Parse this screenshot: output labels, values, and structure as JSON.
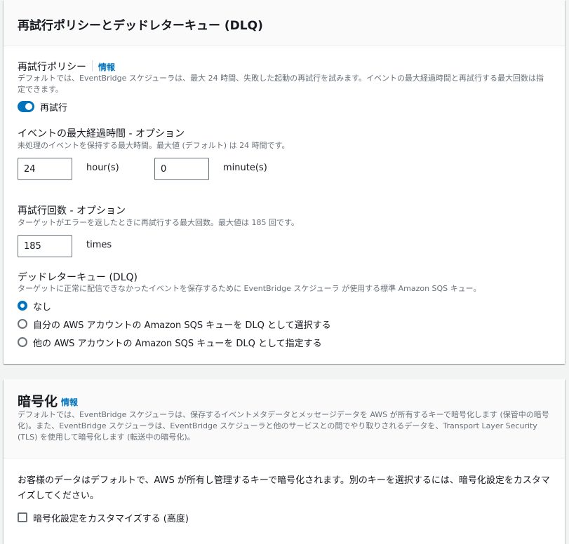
{
  "retry_section": {
    "title": "再試行ポリシーとデッドレターキュー (DLQ)",
    "retry_policy": {
      "label": "再試行ポリシー",
      "info": "情報",
      "description": "デフォルトでは、EventBridge スケジューラは、最大 24 時間、失敗した起動の再試行を試みます。イベントの最大経過時間と再試行する最大回数は指定できます。",
      "toggle_label": "再試行",
      "toggle_on": true
    },
    "max_age": {
      "label": "イベントの最大経過時間 - オプション",
      "description": "未処理のイベントを保持する最大時間。最大値 (デフォルト) は 24 時間です。",
      "hours_value": "24",
      "hours_unit": "hour(s)",
      "minutes_value": "0",
      "minutes_unit": "minute(s)"
    },
    "retry_count": {
      "label": "再試行回数 - オプション",
      "description": "ターゲットがエラーを返したときに再試行する最大回数。最大値は 185 回です。",
      "value": "185",
      "unit": "times"
    },
    "dlq": {
      "label": "デッドレターキュー (DLQ)",
      "description": "ターゲットに正常に配信できなかったイベントを保存するために EventBridge スケジューラ が使用する標準 Amazon SQS キュー。",
      "options": [
        {
          "label": "なし",
          "checked": true
        },
        {
          "label": "自分の AWS アカウントの Amazon SQS キューを DLQ として選択する",
          "checked": false
        },
        {
          "label": "他の AWS アカウントの Amazon SQS キューを DLQ として指定する",
          "checked": false
        }
      ]
    }
  },
  "encryption_section": {
    "title": "暗号化",
    "info": "情報",
    "description": "デフォルトでは、EventBridge スケジューラは、保存するイベントメタデータとメッセージデータを AWS が所有するキーで暗号化します (保管中の暗号化)。また、EventBridge スケジューラは、EventBridge スケジューラと他のサービスとの間でやり取りされるデータを、Transport Layer Security (TLS) を使用して暗号化します (転送中の暗号化)。",
    "body": "お客様のデータはデフォルトで、AWS が所有し管理するキーで暗号化されます。別のキーを選択するには、暗号化設定をカスタマイズしてください。",
    "customize_label": "暗号化設定をカスタマイズする (高度)",
    "customize_checked": false
  }
}
